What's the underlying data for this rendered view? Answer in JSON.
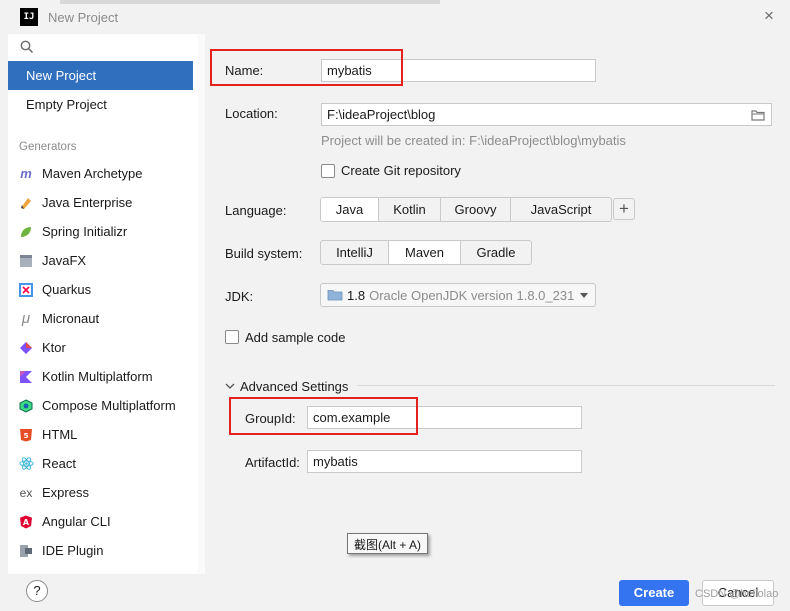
{
  "window": {
    "app_icon_text": "IJ",
    "title": "New Project",
    "close_glyph": "×"
  },
  "sidebar": {
    "items": [
      {
        "label": "New Project",
        "active": true
      },
      {
        "label": "Empty Project",
        "active": false
      }
    ],
    "generators_header": "Generators",
    "generators": [
      {
        "label": "Maven Archetype",
        "icon": "maven-icon"
      },
      {
        "label": "Java Enterprise",
        "icon": "java-enterprise-icon"
      },
      {
        "label": "Spring Initializr",
        "icon": "spring-icon"
      },
      {
        "label": "JavaFX",
        "icon": "javafx-icon"
      },
      {
        "label": "Quarkus",
        "icon": "quarkus-icon"
      },
      {
        "label": "Micronaut",
        "icon": "micronaut-icon"
      },
      {
        "label": "Ktor",
        "icon": "ktor-icon"
      },
      {
        "label": "Kotlin Multiplatform",
        "icon": "kotlin-icon"
      },
      {
        "label": "Compose Multiplatform",
        "icon": "compose-icon"
      },
      {
        "label": "HTML",
        "icon": "html5-icon"
      },
      {
        "label": "React",
        "icon": "react-icon"
      },
      {
        "label": "Express",
        "icon": "express-icon"
      },
      {
        "label": "Angular CLI",
        "icon": "angular-icon"
      },
      {
        "label": "IDE Plugin",
        "icon": "plugin-icon"
      }
    ]
  },
  "form": {
    "name_label": "Name:",
    "name_value": "mybatis",
    "location_label": "Location:",
    "location_value": "F:\\ideaProject\\blog",
    "location_hint": "Project will be created in: F:\\ideaProject\\blog\\mybatis",
    "git_label": "Create Git repository",
    "git_checked": false,
    "language_label": "Language:",
    "languages": [
      "Java",
      "Kotlin",
      "Groovy",
      "JavaScript"
    ],
    "language_selected": "Java",
    "add_language_glyph": "+",
    "build_label": "Build system:",
    "builds": [
      "IntelliJ",
      "Maven",
      "Gradle"
    ],
    "build_selected": "Maven",
    "jdk_label": "JDK:",
    "jdk_version": "1.8",
    "jdk_name": "Oracle OpenJDK version 1.8.0_231",
    "sample_label": "Add sample code",
    "sample_checked": false,
    "advanced_label": "Advanced Settings",
    "groupid_label": "GroupId:",
    "groupid_value": "com.example",
    "artifactid_label": "ArtifactId:",
    "artifactid_value": "mybatis"
  },
  "tooltip": "截图(Alt + A)",
  "footer": {
    "help_glyph": "?",
    "create_label": "Create",
    "cancel_label": "Cancel",
    "watermark": "CSDN @hellolao"
  },
  "colors": {
    "accent": "#2f6fbe",
    "primary_button": "#3574f0",
    "highlight": "#e4211f"
  }
}
